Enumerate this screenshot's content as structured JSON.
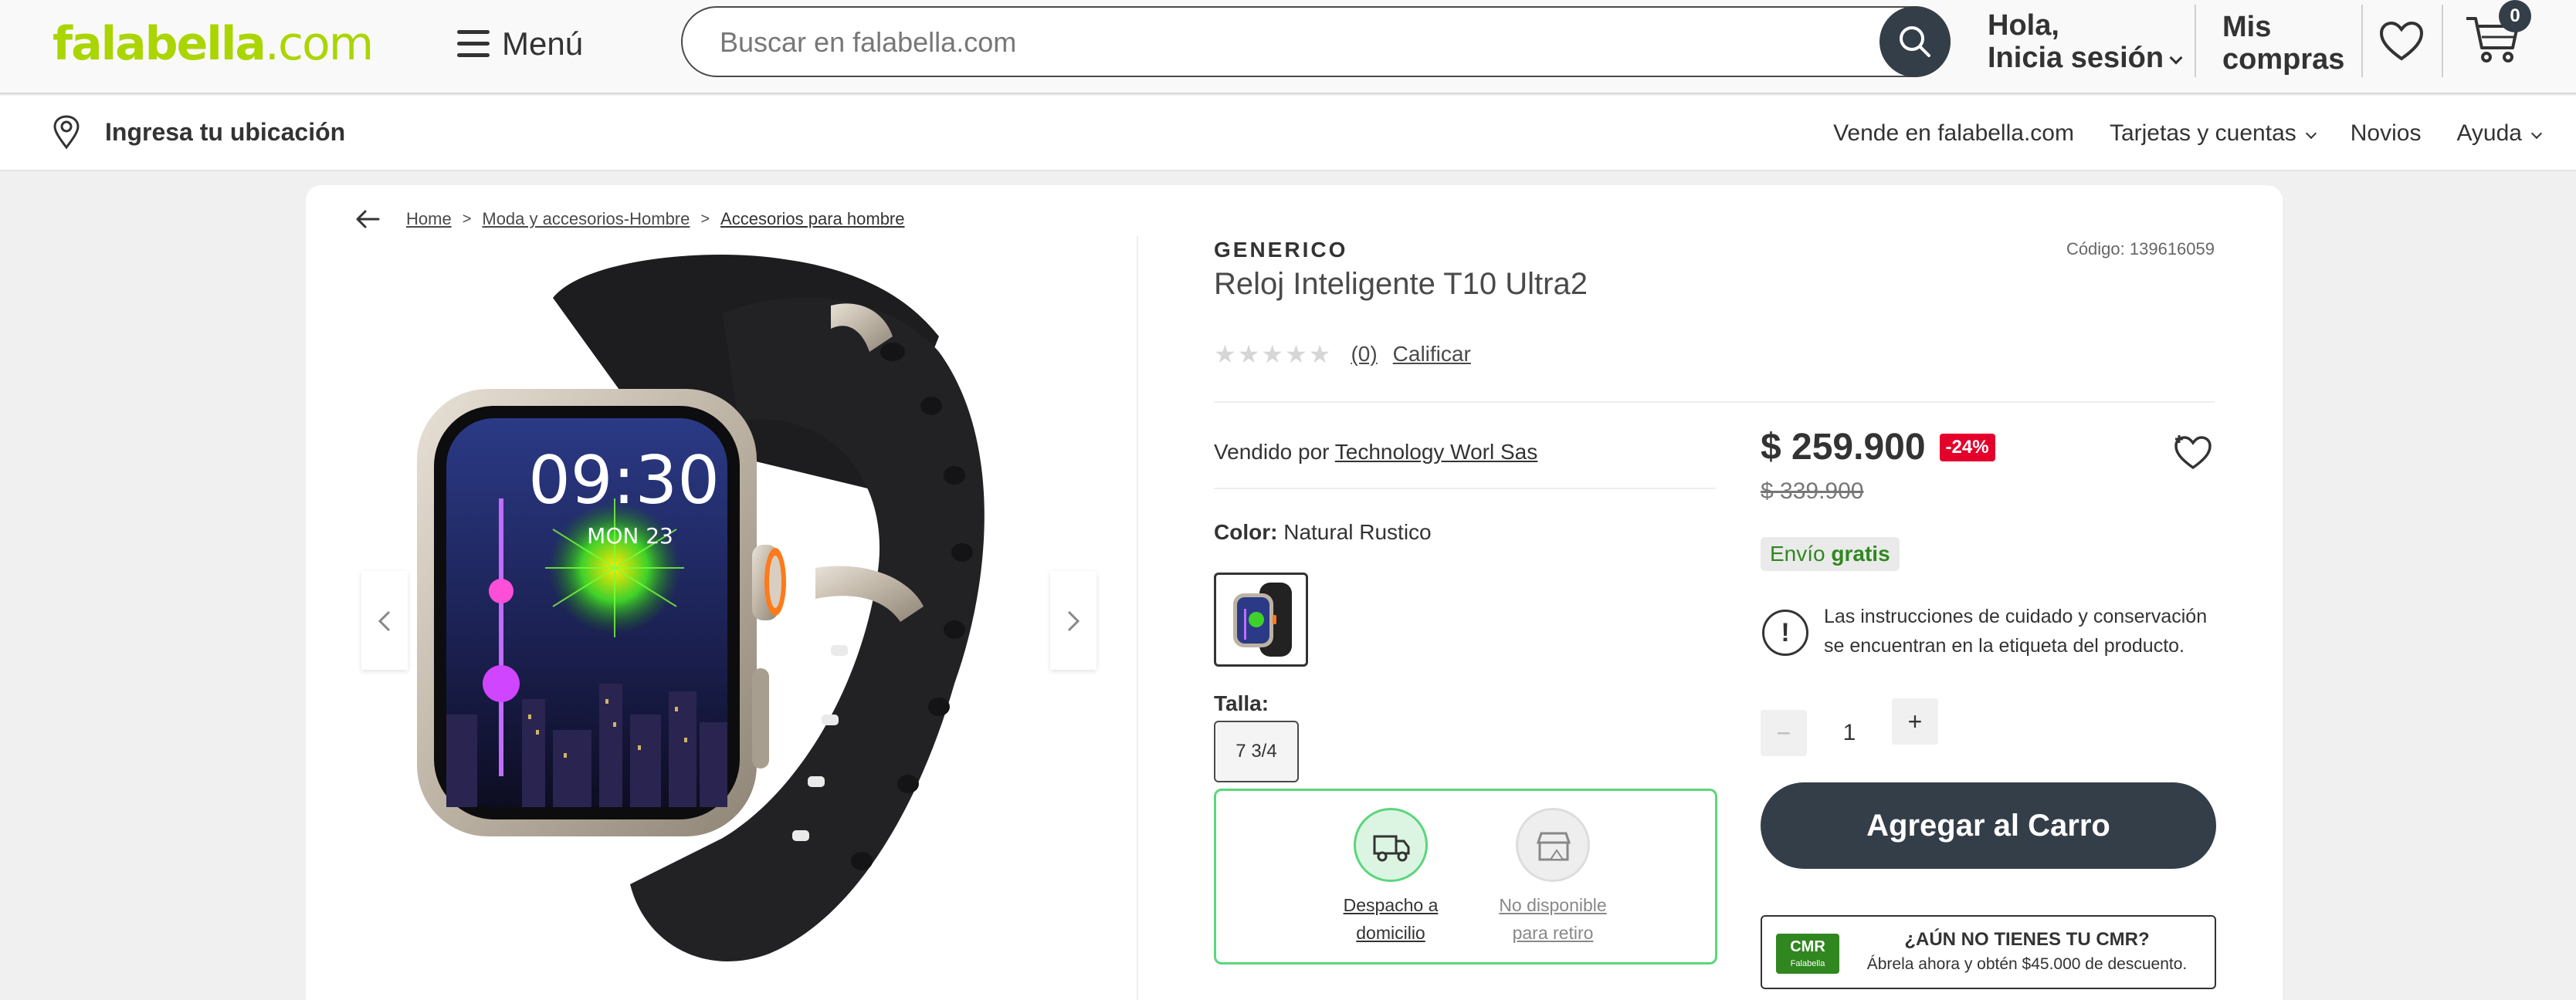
{
  "header": {
    "logo_main": "falabella",
    "logo_suffix": ".com",
    "menu_label": "Menú",
    "search_placeholder": "Buscar en falabella.com",
    "greeting_line1": "Hola,",
    "greeting_line2": "Inicia sesión",
    "purchases_line1": "Mis",
    "purchases_line2": "compras",
    "cart_count": "0"
  },
  "subbar": {
    "location_label": "Ingresa tu ubicación",
    "links": [
      "Vende en falabella.com",
      "Tarjetas y cuentas",
      "Novios",
      "Ayuda"
    ]
  },
  "breadcrumb": [
    "Home",
    "Moda y accesorios-Hombre",
    "Accesorios para hombre"
  ],
  "product": {
    "brand": "GENERICO",
    "code": "Código: 139616059",
    "name": "Reloj Inteligente T10 Ultra2",
    "rating_count": "(0)",
    "rate_label": "Calificar",
    "sold_by_label": "Vendido por",
    "seller": "Technology Worl Sas",
    "color_label": "Color:",
    "color_value": "Natural Rustico",
    "size_label": "Talla:",
    "size_value": "7 3/4",
    "watch_time": "09:30",
    "watch_date": "MON 23"
  },
  "delivery": {
    "home_line1": "Despacho a",
    "home_line2": "domicilio",
    "pickup_line1": "No disponible",
    "pickup_line2": "para retiro"
  },
  "pricing": {
    "price": "$ 259.900",
    "discount": "-24%",
    "old_price": "$ 339.900",
    "shipping_label": "Envío",
    "shipping_value": "gratis",
    "care_note": "Las instrucciones de cuidado y conservación se encuentran en la etiqueta del producto.",
    "qty_minus": "−",
    "qty_value": "1",
    "qty_plus": "+",
    "add_to_cart": "Agregar al Carro"
  },
  "cmr": {
    "logo_text": "CMR",
    "logo_sub": "Falabella",
    "title": "¿AÚN NO TIENES TU CMR?",
    "subtitle": "Ábrela ahora y obtén $45.000 de descuento."
  },
  "colors": {
    "brand_green": "#aad500",
    "dark": "#343e48",
    "discount_red": "#e4002b",
    "free_green": "#30871f",
    "delivery_border": "#5ad67c"
  }
}
